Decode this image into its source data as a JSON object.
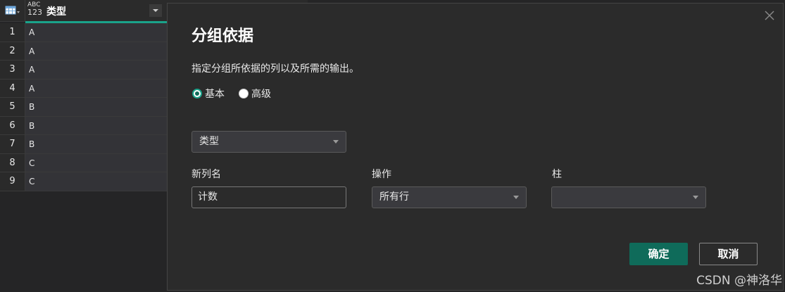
{
  "grid": {
    "column": {
      "type_top": "ABC",
      "type_bottom": "123",
      "name": "类型"
    },
    "rows": [
      {
        "n": "1",
        "v": "A"
      },
      {
        "n": "2",
        "v": "A"
      },
      {
        "n": "3",
        "v": "A"
      },
      {
        "n": "4",
        "v": "A"
      },
      {
        "n": "5",
        "v": "B"
      },
      {
        "n": "6",
        "v": "B"
      },
      {
        "n": "7",
        "v": "B"
      },
      {
        "n": "8",
        "v": "C"
      },
      {
        "n": "9",
        "v": "C"
      }
    ]
  },
  "dialog": {
    "title": "分组依据",
    "description": "指定分组所依据的列以及所需的输出。",
    "mode_basic": "基本",
    "mode_advanced": "高级",
    "selected_mode": "基本",
    "group_by_column": "类型",
    "new_column_label": "新列名",
    "new_column_value": "计数",
    "operation_label": "操作",
    "operation_value": "所有行",
    "column_label": "柱",
    "column_value": "",
    "ok_label": "确定",
    "cancel_label": "取消"
  },
  "watermark": "CSDN @神洛华",
  "colors": {
    "accent": "#0f6b5a",
    "teal_bar": "#1aa38a",
    "background": "#252526",
    "dialog_bg": "#2b2b2b"
  },
  "icons": {
    "table_menu": "table-icon",
    "close": "close-icon",
    "dropdown": "chevron-down-icon"
  }
}
